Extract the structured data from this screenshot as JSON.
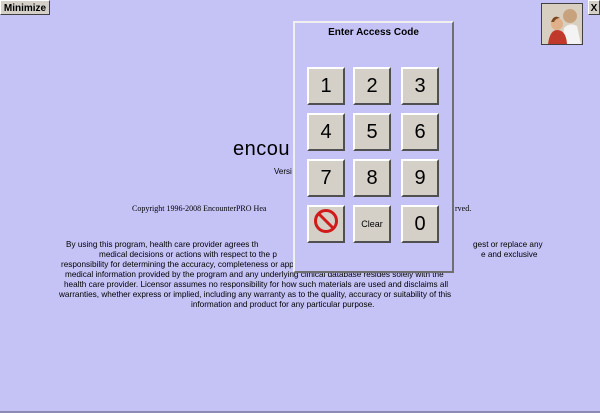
{
  "window": {
    "minimize_label": "Minimize",
    "close_label": "X"
  },
  "background": {
    "brand_prefix": "encou",
    "version_prefix": "Versi",
    "copyright_left": "Copyright 1996-2008 EncounterPRO Hea",
    "copyright_right": "rved.",
    "disclaimer_lines": [
      {
        "left": "By using this program, health care provider agrees th",
        "right": "gest or replace any"
      },
      {
        "left": "medical decisions or actions with respect to the p",
        "right": "e and exclusive"
      },
      {
        "left": "responsibility for determining the accuracy, completeness or appropriateness of any diagnostic, clinical or",
        "right": ""
      },
      {
        "left": "medical information provided by the program and any underlying clinical database resides solely with the",
        "right": ""
      },
      {
        "left": "health care provider.  Licensor assumes no responsibility for how such materials are used and disclaims all",
        "right": ""
      },
      {
        "left": "warranties, whether express or implied, including any warranty as to the quality, accuracy or suitability of this",
        "right": ""
      },
      {
        "left": "information and product for any particular purpose.",
        "right": ""
      }
    ]
  },
  "dialog": {
    "title": "Enter Access Code",
    "keys": {
      "k1": "1",
      "k2": "2",
      "k3": "3",
      "k4": "4",
      "k5": "5",
      "k6": "6",
      "k7": "7",
      "k8": "8",
      "k9": "9",
      "clear": "Clear",
      "k0": "0"
    },
    "cancel_icon": "no-entry-icon"
  },
  "avatar_icon": "user-photo-icon"
}
